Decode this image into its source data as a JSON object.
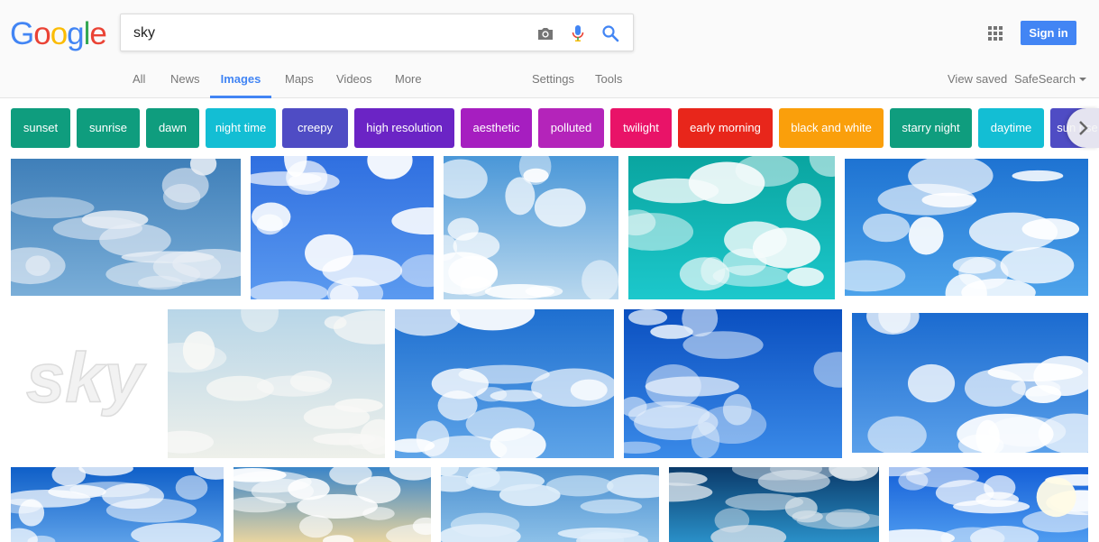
{
  "logo": {
    "letters": [
      "G",
      "o",
      "o",
      "g",
      "l",
      "e"
    ],
    "colors": [
      "#4285f4",
      "#ea4335",
      "#fbbc05",
      "#4285f4",
      "#34a853",
      "#ea4335"
    ]
  },
  "search": {
    "query": "sky",
    "placeholder": ""
  },
  "header": {
    "signin_label": "Sign in",
    "apps_icon": "apps-grid-icon"
  },
  "nav": {
    "tabs": [
      "All",
      "News",
      "Images",
      "Maps",
      "Videos",
      "More"
    ],
    "active": "Images",
    "settings": "Settings",
    "tools": "Tools",
    "view_saved": "View saved",
    "safesearch": "SafeSearch"
  },
  "chips": [
    {
      "label": "sunset",
      "color": "#0f9d7e"
    },
    {
      "label": "sunrise",
      "color": "#0f9d7e"
    },
    {
      "label": "dawn",
      "color": "#0f9d7e"
    },
    {
      "label": "night time",
      "color": "#13bed4"
    },
    {
      "label": "creepy",
      "color": "#4f4cc4"
    },
    {
      "label": "high resolution",
      "color": "#6b24c5"
    },
    {
      "label": "aesthetic",
      "color": "#a61ec0"
    },
    {
      "label": "polluted",
      "color": "#b424ba"
    },
    {
      "label": "twilight",
      "color": "#e91368"
    },
    {
      "label": "early morning",
      "color": "#e8261b"
    },
    {
      "label": "black and white",
      "color": "#fa9f0b"
    },
    {
      "label": "starry night",
      "color": "#0f9d7e"
    },
    {
      "label": "daytime",
      "color": "#13bed4"
    },
    {
      "label": "sun rise",
      "color": "#4f4cc4"
    }
  ],
  "images": [
    {
      "name": "sky-clouds-blue",
      "top": "#3f7fb9",
      "bottom": "#7aaed8",
      "clouds": "#e8eef5",
      "text": ""
    },
    {
      "name": "sky-bright-clouds",
      "top": "#2f6fe0",
      "bottom": "#5b9af0",
      "clouds": "#ffffff",
      "text": ""
    },
    {
      "name": "sky-light-blue",
      "top": "#4a97d8",
      "bottom": "#b9d8ee",
      "clouds": "#ffffff",
      "text": ""
    },
    {
      "name": "sky-teal-cumulus",
      "top": "#0aa5a0",
      "bottom": "#1cc8cc",
      "clouds": "#f5fbfb",
      "text": ""
    },
    {
      "name": "sky-blue-puffy",
      "top": "#1e73d2",
      "bottom": "#4ca2ea",
      "clouds": "#ffffff",
      "text": ""
    },
    {
      "name": "sky-logo",
      "top": "#ffffff",
      "bottom": "#ffffff",
      "clouds": "#ffffff",
      "text": "sky"
    },
    {
      "name": "sky-above-clouds",
      "top": "#b8d6e8",
      "bottom": "#eef0ea",
      "clouds": "#f8f8f6",
      "text": ""
    },
    {
      "name": "sky-scattered-clouds",
      "top": "#1e6fd0",
      "bottom": "#5ea4e8",
      "clouds": "#ffffff",
      "text": ""
    },
    {
      "name": "sky-deep-blue",
      "top": "#0a4fc0",
      "bottom": "#3a8ae8",
      "clouds": "#e6f0fb",
      "text": ""
    },
    {
      "name": "sky-blue-cloudscape",
      "top": "#1b6bd0",
      "bottom": "#5aa0ea",
      "clouds": "#ffffff",
      "text": ""
    },
    {
      "name": "sky-wispy",
      "top": "#0f5fc8",
      "bottom": "#5ca0e8",
      "clouds": "#ffffff",
      "text": ""
    },
    {
      "name": "sky-gradient",
      "top": "#3a85c8",
      "bottom": "#e8d4a0",
      "clouds": "#ffffff",
      "text": ""
    },
    {
      "name": "sky-streaks",
      "top": "#4a8fd0",
      "bottom": "#8cc0e8",
      "clouds": "#dfeefa",
      "text": ""
    },
    {
      "name": "sky-dark-cloud",
      "top": "#0a3a6a",
      "bottom": "#2a90c8",
      "clouds": "#d8e2ea",
      "text": ""
    },
    {
      "name": "sky-sun",
      "top": "#1560d8",
      "bottom": "#4f9cf0",
      "clouds": "#ffffff",
      "text": ""
    }
  ]
}
